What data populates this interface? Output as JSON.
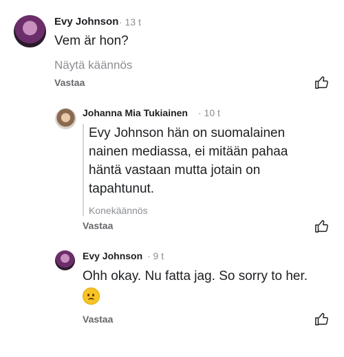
{
  "comments": [
    {
      "author": "Evy Johnson",
      "time": "· 13 t",
      "text": "Vem är hon?",
      "translate_link": "Näytä käännös",
      "reply_label": "Vastaa"
    },
    {
      "author": "Johanna Mia Tukiainen",
      "time": "· 10 t",
      "text_lines": [
        "Evy Johnson hän on suomalainen",
        "nainen mediassa, ei mitään pahaa",
        "häntä vastaan mutta jotain on",
        "tapahtunut."
      ],
      "translation_note": "Konekäännös",
      "reply_label": "Vastaa"
    },
    {
      "author": "Evy Johnson",
      "time": "· 9 t",
      "text": "Ohh okay. Nu fatta jag. So sorry to her.",
      "emoji": "frowning-face-emoji",
      "reply_label": "Vastaa"
    }
  ],
  "icons": {
    "like": "thumbs-up-icon"
  }
}
